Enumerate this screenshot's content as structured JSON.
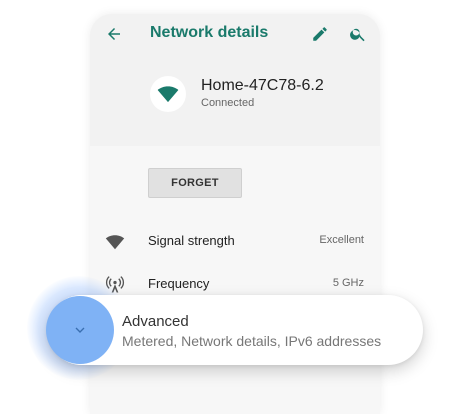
{
  "appbar": {
    "title": "Network details",
    "back_icon": "arrow-back-icon",
    "edit_icon": "pencil-icon",
    "search_icon": "search-icon"
  },
  "network": {
    "name": "Home-47C78-6.2",
    "status": "Connected",
    "icon": "wifi-icon"
  },
  "forget_label": "FORGET",
  "rows": [
    {
      "label": "Signal strength",
      "value": "Excellent",
      "icon": "wifi-signal-icon"
    },
    {
      "label": "Frequency",
      "value": "5 GHz",
      "icon": "antenna-icon"
    }
  ],
  "advanced": {
    "title": "Advanced",
    "subtitle": "Metered, Network details, IPv6 addresses",
    "icon": "chevron-down-icon"
  },
  "colors": {
    "accent": "#1a7a6b",
    "highlight": "#7fb2f5"
  }
}
